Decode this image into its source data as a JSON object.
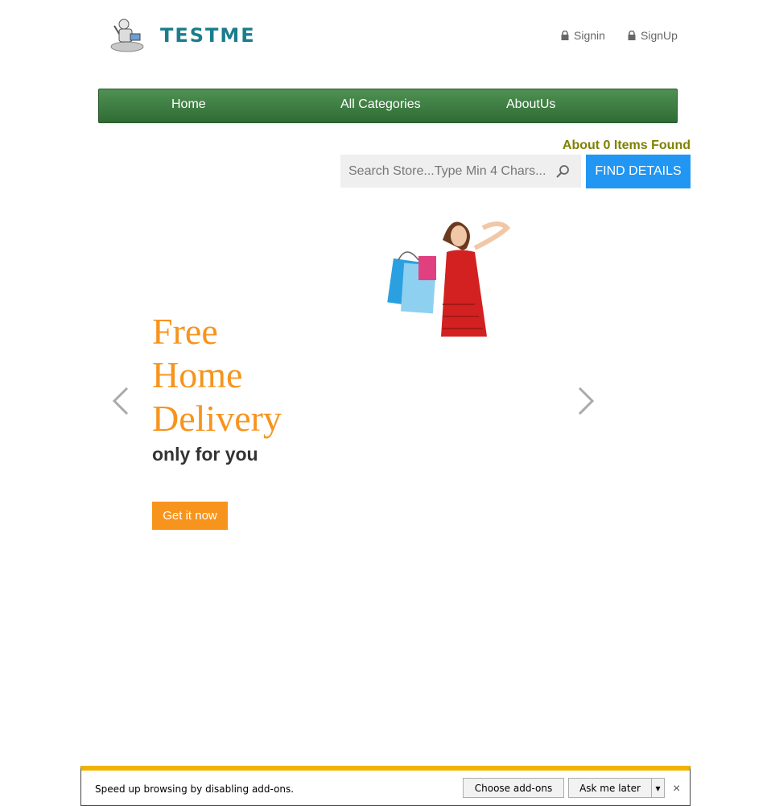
{
  "header": {
    "logo_text": "TESTME",
    "signin_label": "Signin",
    "signup_label": "SignUp"
  },
  "nav": {
    "items": [
      {
        "label": "Home"
      },
      {
        "label": "All Categories"
      },
      {
        "label": "AboutUs"
      }
    ]
  },
  "search": {
    "items_found": "About 0 Items Found",
    "placeholder": "Search Store...Type Min 4 Chars...",
    "button_label": "FIND DETAILS"
  },
  "hero": {
    "title_lines": [
      "Free",
      "Home",
      "Delivery"
    ],
    "subtitle": "only for you",
    "cta_label": "Get it now"
  },
  "notification": {
    "message": "Speed up browsing by disabling add-ons.",
    "choose_label": "Choose add-ons",
    "later_label": "Ask me later",
    "dropdown_glyph": "▾",
    "close_glyph": "×"
  },
  "colors": {
    "nav_green": "#3a7d3f",
    "accent_orange": "#f7941d",
    "button_blue": "#2196f3",
    "logo_teal": "#1b7d8c",
    "items_found": "#808000",
    "notif_yellow": "#f0b400"
  }
}
